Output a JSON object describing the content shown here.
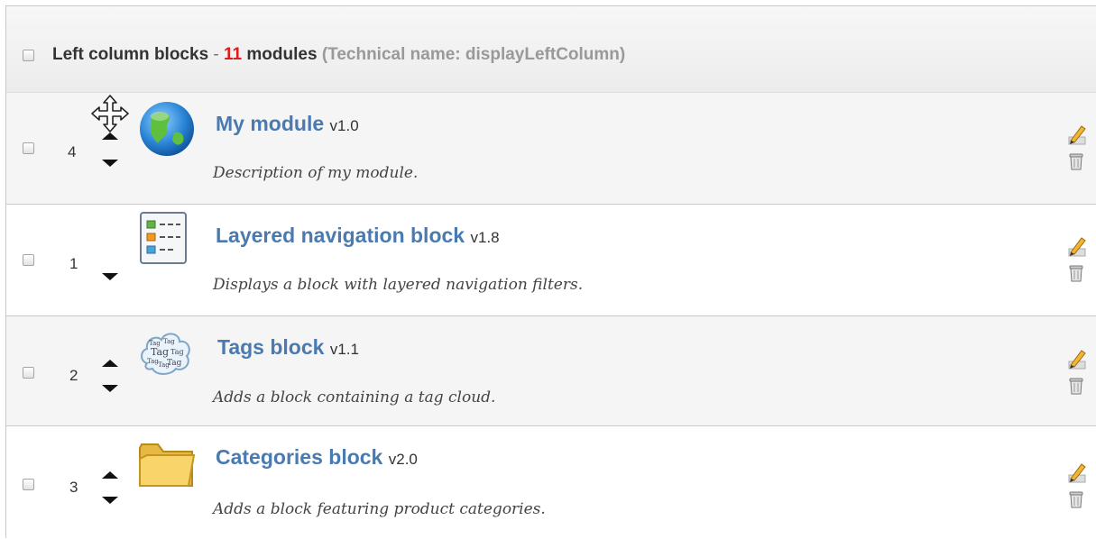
{
  "header": {
    "title": "Left column blocks",
    "dash": "-",
    "count": "11",
    "modules_word": "modules",
    "technical": "(Technical name: displayLeftColumn)"
  },
  "modules": [
    {
      "position": "4",
      "name": "My module",
      "version": "v1.0",
      "description": "Description of my module.",
      "icon": "globe-icon"
    },
    {
      "position": "1",
      "name": "Layered navigation block",
      "version": "v1.8",
      "description": "Displays a block with layered navigation filters.",
      "icon": "layered-navigation-icon"
    },
    {
      "position": "2",
      "name": "Tags block",
      "version": "v1.1",
      "description": "Adds a block containing a tag cloud.",
      "icon": "tag-cloud-icon",
      "icon_text": "Tag"
    },
    {
      "position": "3",
      "name": "Categories block",
      "version": "v2.0",
      "description": "Adds a block featuring product categories.",
      "icon": "folder-icon"
    }
  ],
  "colors": {
    "title_link": "#4a7ab0",
    "count_red": "#e01b1b",
    "technical_gray": "#999999"
  }
}
